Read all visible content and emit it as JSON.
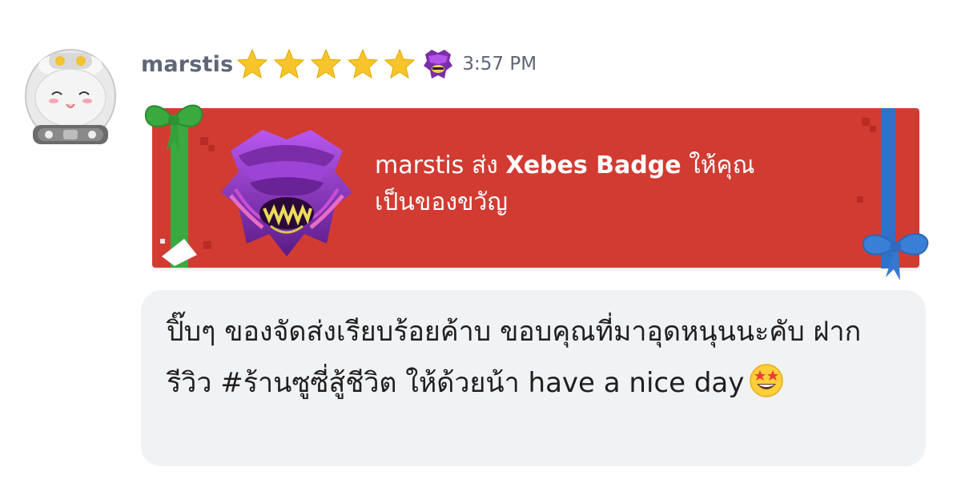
{
  "message": {
    "sender": "marstis",
    "time": "3:57 PM",
    "star_count": 5,
    "icons": {
      "avatar": "astronaut-helmet-avatar-icon",
      "star": "star-icon",
      "badge": "xebes-badge-icon",
      "emoji": "star-struck-emoji-icon"
    }
  },
  "gift": {
    "sender": "marstis",
    "verb": "ส่ง",
    "item": "Xebes Badge",
    "suffix": "ให้คุณ",
    "line2": "เป็นของขวัญ"
  },
  "bubble": {
    "text": "ปิ๊บๆ ของจัดส่งเรียบร้อยค้าบ ขอบคุณที่มาอุดหนุนนะคับ ฝากรีวิว #ร้านซูซี่สู้ชีวิต ให้ด้วยน้า have a nice day"
  },
  "colors": {
    "gift_red": "#d23b32",
    "ribbon_green": "#3aa93f",
    "ribbon_blue": "#2f72c9",
    "bubble_bg": "#f1f2f4",
    "name_gray": "#5f6677",
    "star_gold": "#f7c52b"
  }
}
